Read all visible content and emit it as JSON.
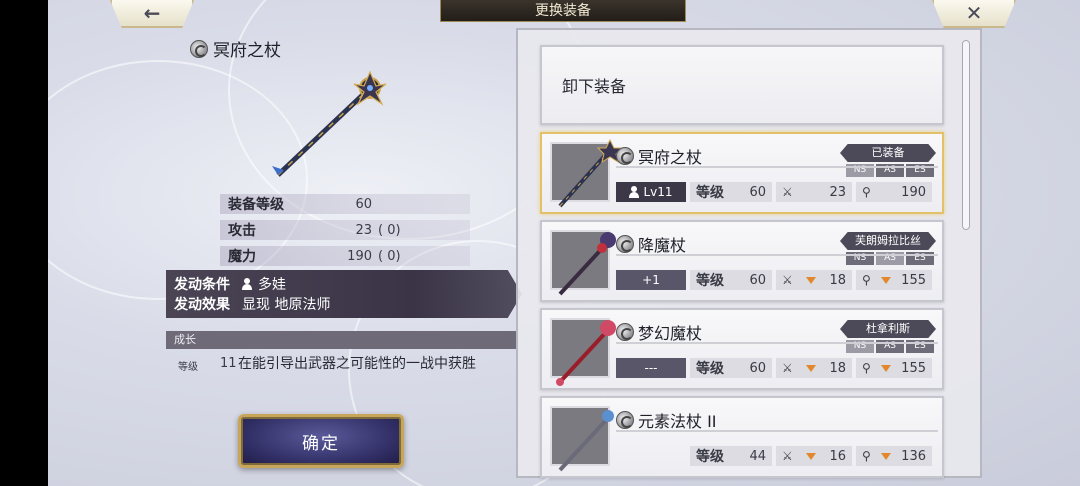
{
  "header": {
    "title": "更换装备",
    "back_icon": "←",
    "close_icon": "✕"
  },
  "detail": {
    "name": "冥府之杖",
    "stats": [
      {
        "label": "装备等级",
        "value": "60",
        "extra": ""
      },
      {
        "label": "攻击",
        "value": "23",
        "extra": "(       0)"
      },
      {
        "label": "魔力",
        "value": "190",
        "extra": "(       0)"
      }
    ],
    "activation": {
      "condition_label": "发动条件",
      "condition_value": "多娃",
      "effect_label": "发动效果",
      "effect_value": "显现    地原法师"
    },
    "growth": {
      "title": "成长",
      "level_label": "等级",
      "level": "11",
      "description": "在能引导出武器之可能性的一战中获胜"
    },
    "confirm_label": "确定"
  },
  "list": {
    "unequip_label": "卸下装备",
    "cards": [
      {
        "name": "冥府之杖",
        "tag": "已装备",
        "skills": [
          "NS",
          "AS",
          "ES"
        ],
        "lv_box": "Lv11",
        "level_label": "等级",
        "level": "60",
        "atk": "23",
        "mag": "190",
        "arrows": false
      },
      {
        "name": "降魔杖",
        "tag": "芙朗姆拉比丝",
        "skills": [
          "NS",
          "AS",
          "ES"
        ],
        "lv_box": "+1",
        "level_label": "等级",
        "level": "60",
        "atk": "18",
        "mag": "155",
        "arrows": true
      },
      {
        "name": "梦幻魔杖",
        "tag": "杜拿利斯",
        "skills": [
          "NS",
          "AS",
          "ES"
        ],
        "lv_box": "---",
        "level_label": "等级",
        "level": "60",
        "atk": "18",
        "mag": "155",
        "arrows": true
      },
      {
        "name": "元素法杖 II",
        "tag": "",
        "skills": [],
        "lv_box": "",
        "level_label": "等级",
        "level": "44",
        "atk": "16",
        "mag": "136",
        "arrows": true
      }
    ]
  },
  "colors": {
    "accent_gold": "#e2c16a",
    "panel_dark": "#3c3848",
    "arrow_orange": "#e1892a"
  }
}
